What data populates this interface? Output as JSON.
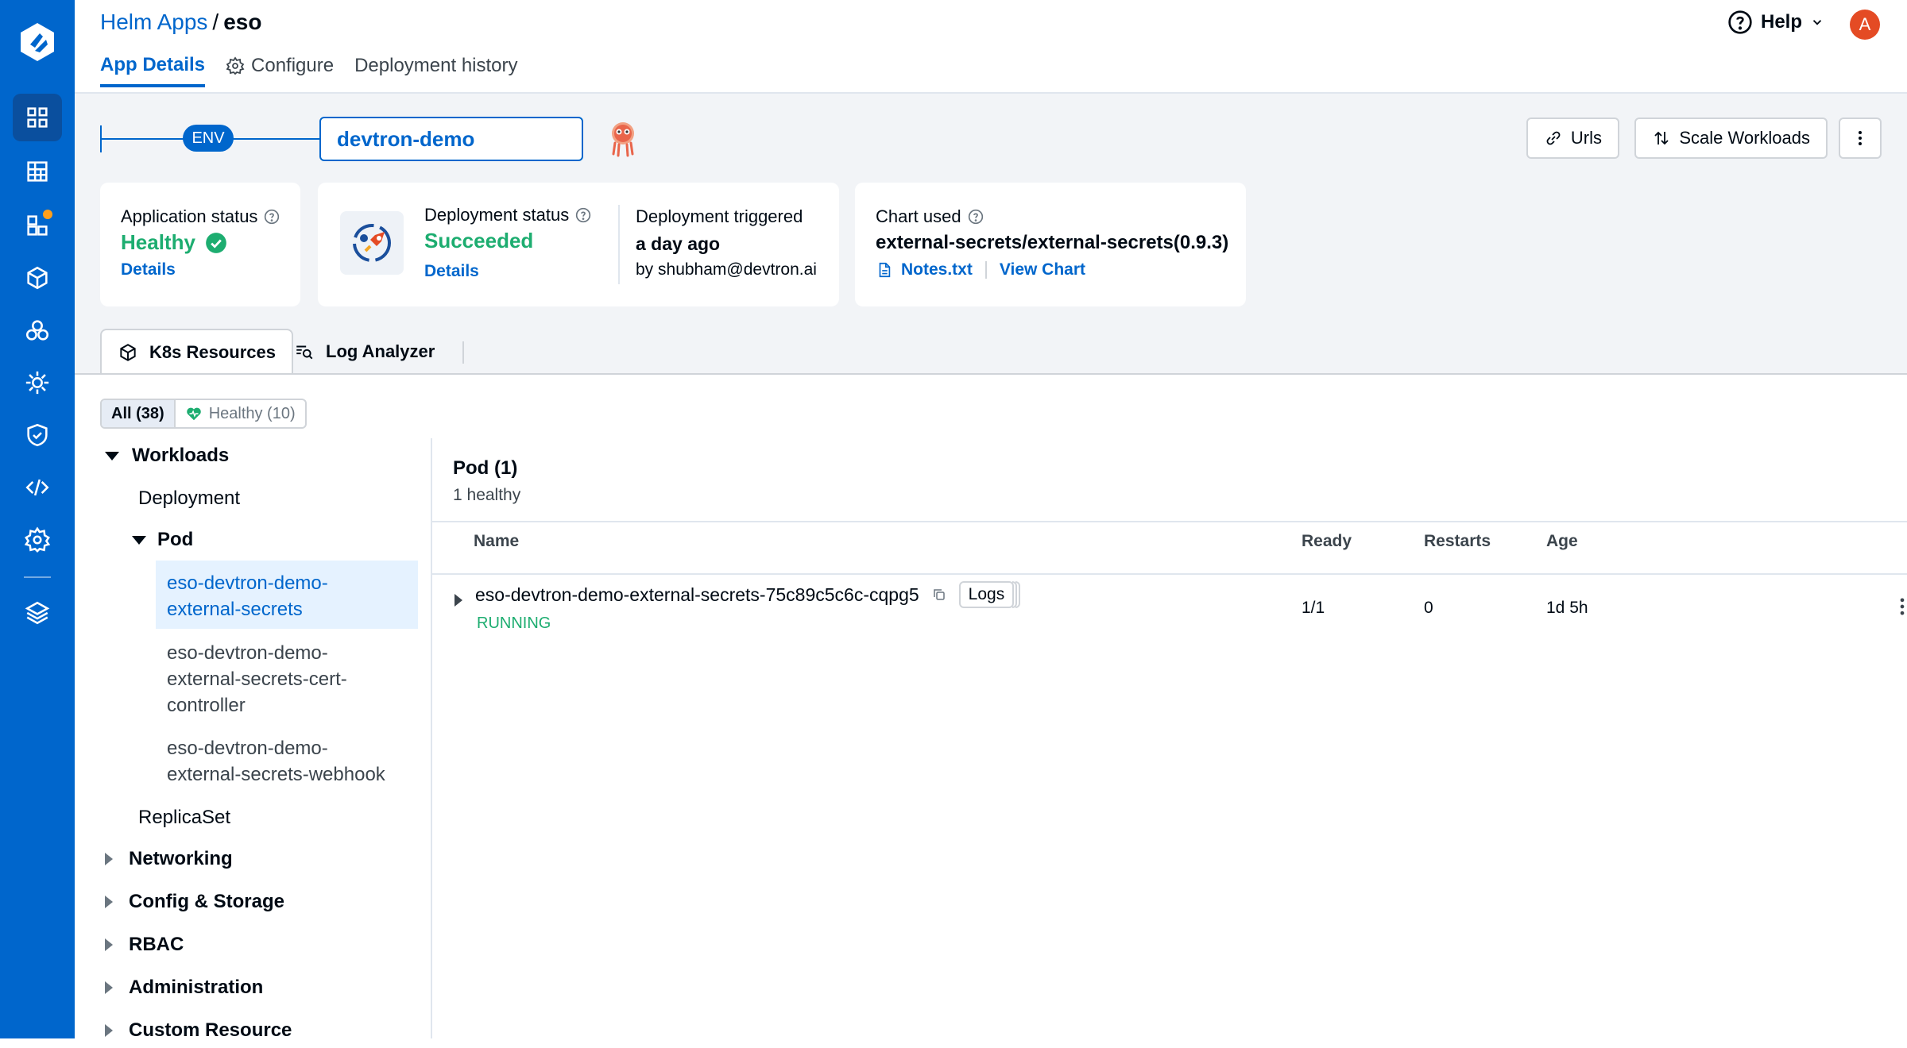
{
  "breadcrumb": {
    "parent": "Helm Apps",
    "separator": "/",
    "current": "eso"
  },
  "tabs": [
    {
      "label": "App Details",
      "active": true
    },
    {
      "label": "Configure",
      "icon": "gear-icon"
    },
    {
      "label": "Deployment history"
    }
  ],
  "header": {
    "help_label": "Help",
    "avatar_initial": "A"
  },
  "env": {
    "badge": "ENV",
    "selected": "devtron-demo"
  },
  "actions": {
    "urls": "Urls",
    "scale": "Scale Workloads"
  },
  "app_status": {
    "label": "Application status",
    "value": "Healthy",
    "link": "Details"
  },
  "deployment_status": {
    "label": "Deployment status",
    "value": "Succeeded",
    "link": "Details",
    "triggered_label": "Deployment triggered",
    "triggered_value": "a day ago",
    "triggered_by": "by shubham@devtron.ai"
  },
  "chart": {
    "label": "Chart used",
    "value": "external-secrets/external-secrets(0.9.3)",
    "notes": "Notes.txt",
    "view": "View Chart"
  },
  "resource_tabs": {
    "k8s": "K8s Resources",
    "logs": "Log Analyzer"
  },
  "filters": {
    "all": "All (38)",
    "healthy": "Healthy (10)"
  },
  "tree": {
    "workloads": "Workloads",
    "deployment": "Deployment",
    "pod": "Pod",
    "pods": [
      {
        "line1": "eso-devtron-demo-",
        "line2": "external-secrets",
        "line3": ""
      },
      {
        "line1": "eso-devtron-demo-",
        "line2": "external-secrets-cert-",
        "line3": "controller"
      },
      {
        "line1": "eso-devtron-demo-",
        "line2": "external-secrets-webhook",
        "line3": ""
      }
    ],
    "replicaset": "ReplicaSet",
    "networking": "Networking",
    "config_storage": "Config & Storage",
    "rbac": "RBAC",
    "administration": "Administration",
    "custom_resource": "Custom Resource"
  },
  "pods_table": {
    "title": "Pod (1)",
    "subtitle": "1 healthy",
    "columns": {
      "name": "Name",
      "ready": "Ready",
      "restarts": "Restarts",
      "age": "Age"
    },
    "rows": [
      {
        "name": "eso-devtron-demo-external-secrets-75c89c5c6c-cqpg5",
        "logs": "Logs",
        "status": "RUNNING",
        "ready": "1/1",
        "restarts": "0",
        "age": "1d 5h"
      }
    ]
  },
  "colors": {
    "brand": "#0066cc",
    "success": "#1dad70",
    "nav_bg": "#0066cc",
    "avatar": "#e44b24"
  }
}
